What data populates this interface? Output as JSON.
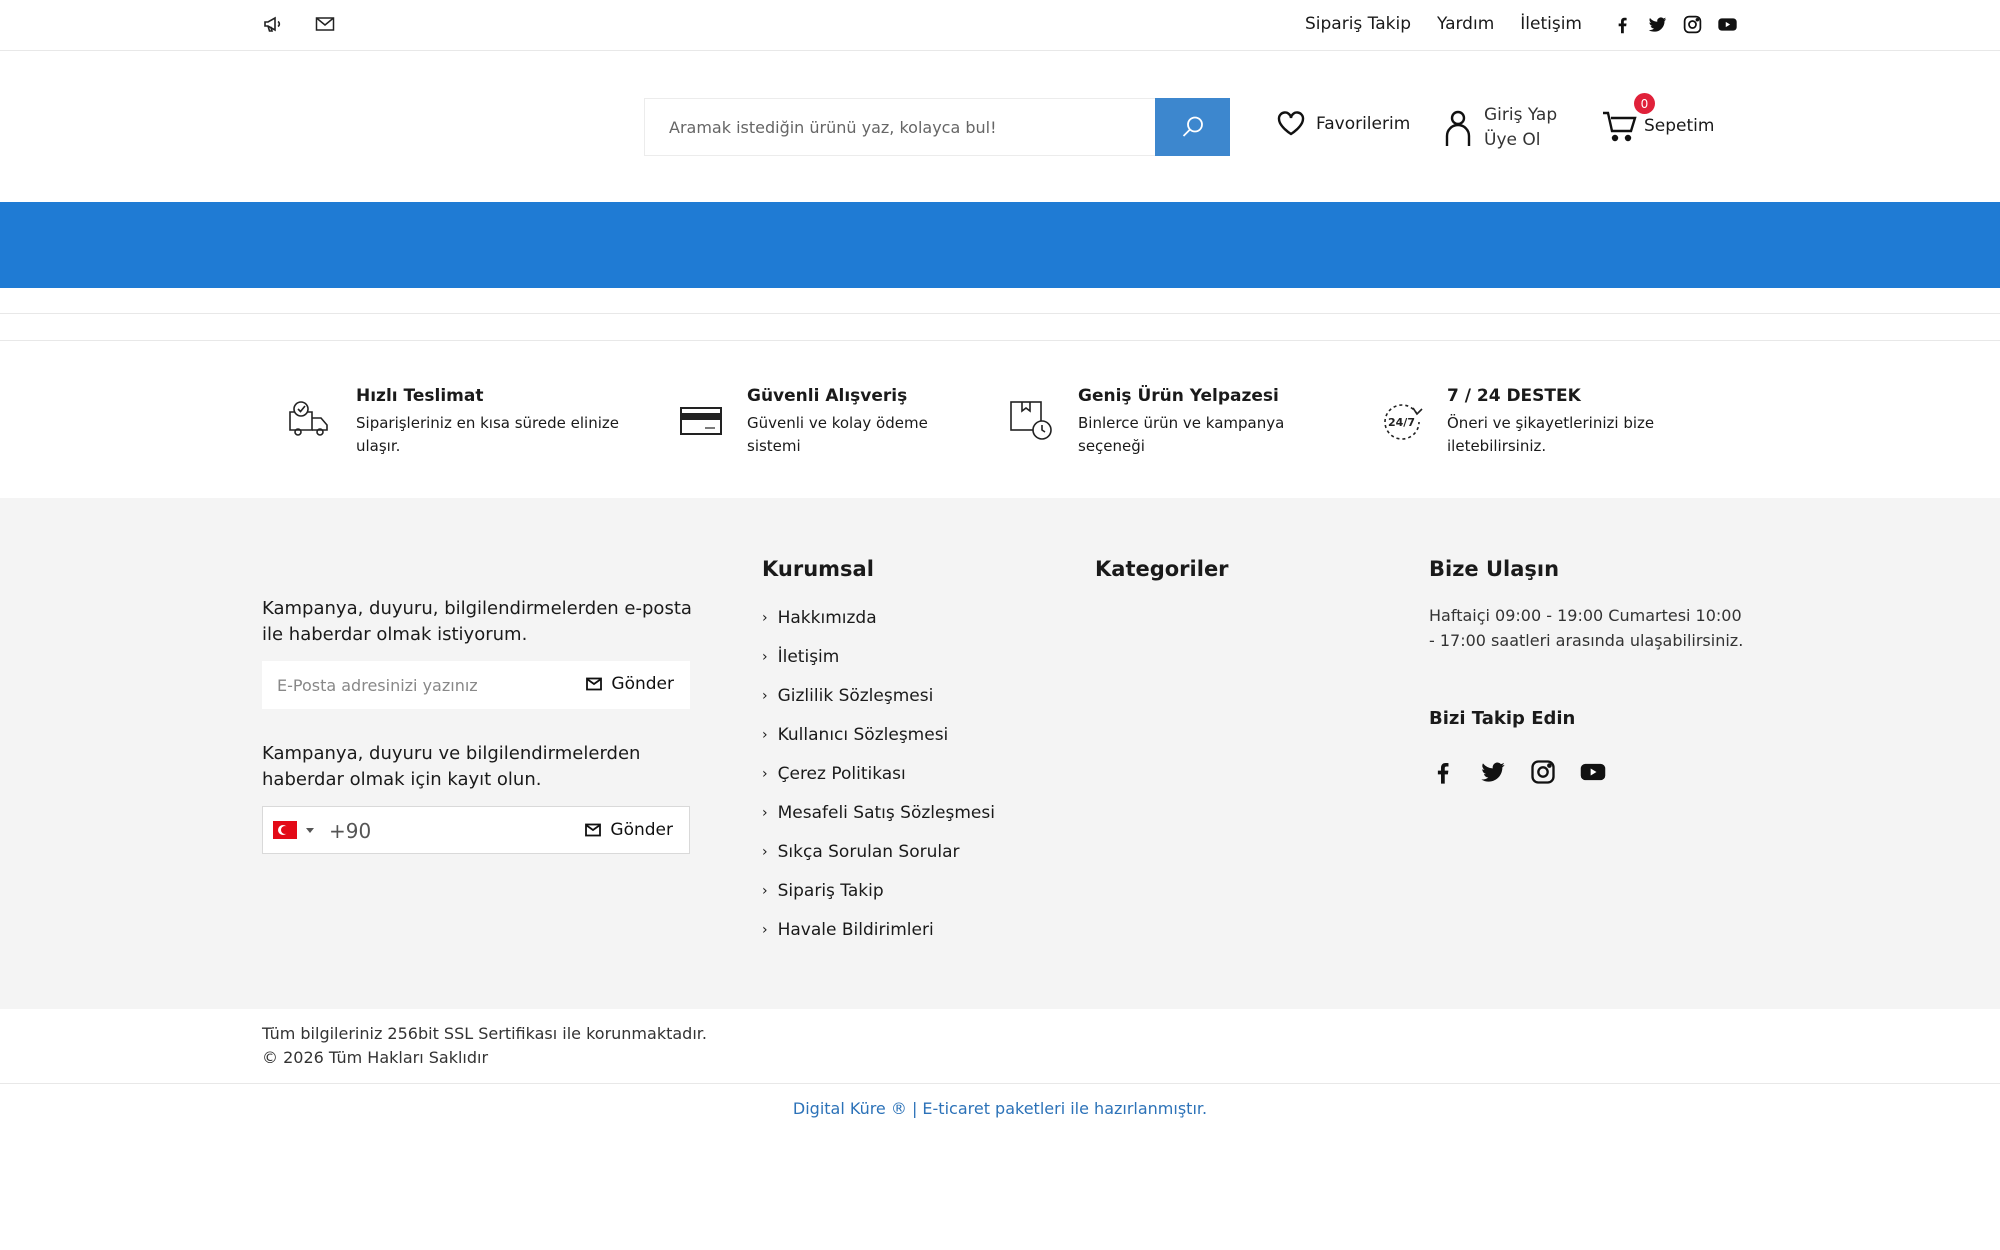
{
  "topbar": {
    "links": [
      "Sipariş Takip",
      "Yardım",
      "İletişim"
    ]
  },
  "header": {
    "search_placeholder": "Aramak istediğin ürünü yaz, kolayca bul!",
    "favorites": "Favorilerim",
    "login": "Giriş Yap",
    "register": "Üye Ol",
    "cart_count": "0",
    "cart": "Sepetim"
  },
  "features": [
    {
      "title": "Hızlı Teslimat",
      "desc": "Siparişleriniz en kısa sürede elinize ulaşır."
    },
    {
      "title": "Güvenli Alışveriş",
      "desc": "Güvenli ve kolay ödeme sistemi"
    },
    {
      "title": "Geniş Ürün Yelpazesi",
      "desc": "Binlerce ürün ve kampanya seçeneği"
    },
    {
      "title": "7 / 24 DESTEK",
      "desc": "Öneri ve şikayetlerinizi bize iletebilirsiniz."
    }
  ],
  "footer": {
    "newsletter_email_text": "Kampanya, duyuru, bilgilendirmelerden e-posta ile haberdar olmak istiyorum.",
    "email_placeholder": "E-Posta adresinizi yazınız",
    "send": "Gönder",
    "newsletter_sms_text": "Kampanya, duyuru ve bilgilendirmelerden haberdar olmak için kayıt olun.",
    "phone_code": "+90",
    "corporate_title": "Kurumsal",
    "corporate_links": [
      "Hakkımızda",
      "İletişim",
      "Gizlilik Sözleşmesi",
      "Kullanıcı Sözleşmesi",
      "Çerez Politikası",
      "Mesafeli Satış Sözleşmesi",
      "Sıkça Sorulan Sorular",
      "Sipariş Takip",
      "Havale Bildirimleri"
    ],
    "categories_title": "Kategoriler",
    "contact_title": "Bize Ulaşın",
    "contact_text": "Haftaiçi 09:00 - 19:00 Cumartesi 10:00 - 17:00 saatleri arasında ulaşabilirsiniz.",
    "follow_title": "Bizi Takip Edin",
    "ssl_text": "Tüm bilgileriniz 256bit SSL Sertifikası ile korunmaktadır.",
    "copyright": "© 2026 Tüm Hakları Saklıdır",
    "credit": "Digital Küre ® | E-ticaret paketleri ile hazırlanmıştır."
  }
}
